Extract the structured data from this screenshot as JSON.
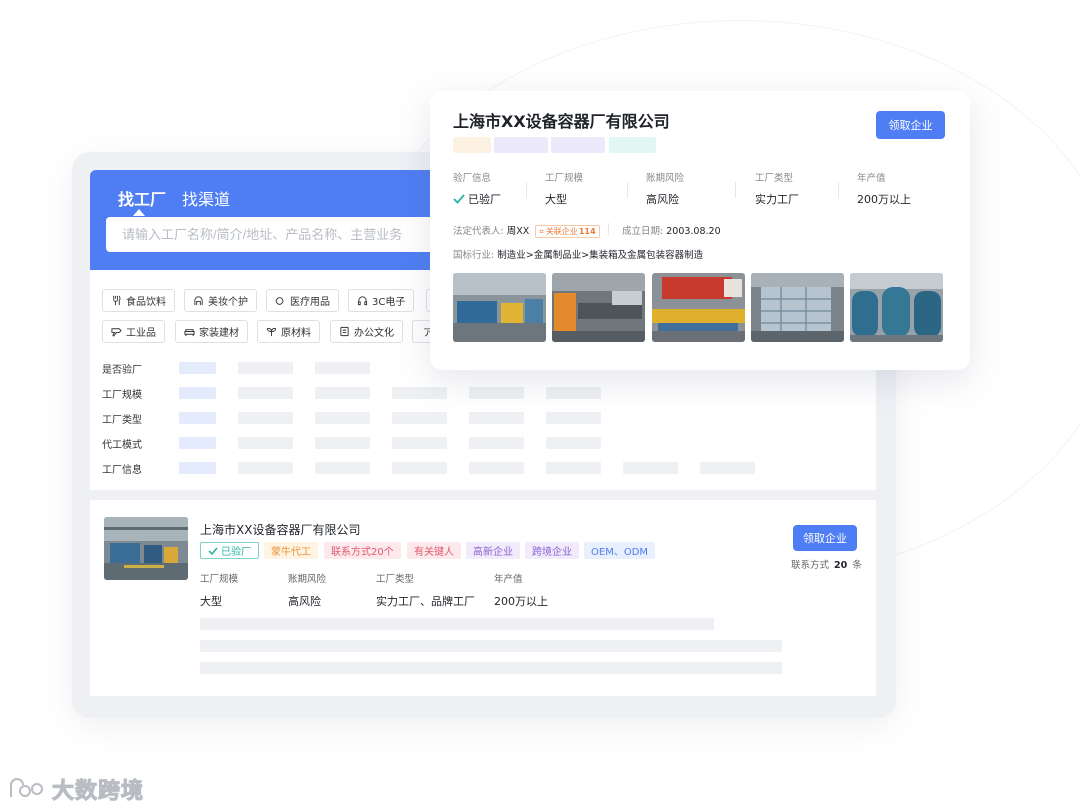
{
  "search": {
    "tabs": [
      {
        "label": "找工厂"
      },
      {
        "label": "找渠道"
      }
    ],
    "placeholder": "请输入工厂名称/简介/地址、产品名称、主营业务"
  },
  "categories": [
    {
      "label": "食品饮料",
      "icon": "food-icon"
    },
    {
      "label": "美妆个护",
      "icon": "beauty-icon"
    },
    {
      "label": "医疗用品",
      "icon": "medical-icon"
    },
    {
      "label": "3C电子",
      "icon": "headphone-icon"
    },
    {
      "label": "工业品",
      "icon": "tool-icon"
    },
    {
      "label": "家装建材",
      "icon": "sofa-icon"
    },
    {
      "label": "原材料",
      "icon": "material-icon"
    },
    {
      "label": "办公文化",
      "icon": "office-icon"
    }
  ],
  "filters": [
    {
      "label": "是否验厂"
    },
    {
      "label": "工厂规模"
    },
    {
      "label": "工厂类型"
    },
    {
      "label": "代工模式"
    },
    {
      "label": "工厂信息"
    }
  ],
  "list_item": {
    "name": "上海市XX设备容器厂有限公司",
    "tags": [
      {
        "label": "已验厂",
        "bg": "#ffffff",
        "fg": "#2bb3a0",
        "border": "#7fd3c6"
      },
      {
        "label": "蒙牛代工",
        "bg": "#fff3e2",
        "fg": "#e8953a"
      },
      {
        "label": "联系方式20个",
        "bg": "#fde9ec",
        "fg": "#e05a70"
      },
      {
        "label": "有关键人",
        "bg": "#fde9ec",
        "fg": "#e05a70"
      },
      {
        "label": "高新企业",
        "bg": "#f1ebfb",
        "fg": "#8a63d2"
      },
      {
        "label": "跨境企业",
        "bg": "#f1ebfb",
        "fg": "#8a63d2"
      },
      {
        "label": "OEM、ODM",
        "bg": "#e8effd",
        "fg": "#4f7df3"
      }
    ],
    "meta": [
      {
        "label": "工厂规模",
        "value": "大型"
      },
      {
        "label": "账期风险",
        "value": "高风险"
      },
      {
        "label": "工厂类型",
        "value": "实力工厂、品牌工厂"
      },
      {
        "label": "年产值",
        "value": "200万以上"
      }
    ],
    "claim_label": "领取企业",
    "contact_prefix": "联系方式",
    "contact_count": "20",
    "contact_suffix": "条"
  },
  "detail": {
    "name": "上海市XX设备容器厂有限公司",
    "claim_label": "领取企业",
    "badge_colors": [
      "#fdf1e3",
      "#ece9fb",
      "#ece9fb",
      "#e2f7f3"
    ],
    "stats": [
      {
        "label": "验厂信息",
        "value": "已验厂"
      },
      {
        "label": "工厂规模",
        "value": "大型"
      },
      {
        "label": "账期风险",
        "value": "高风险"
      },
      {
        "label": "工厂类型",
        "value": "实力工厂"
      },
      {
        "label": "年产值",
        "value": "200万以上"
      }
    ],
    "legal_rep_label": "法定代表人:",
    "legal_rep_value": "周XX",
    "related_label": "关联企业",
    "related_count": "114",
    "founded_label": "成立日期:",
    "founded_value": "2003.08.20",
    "industry_label": "国标行业:",
    "industry_value": "制造业>金属制品业>集装箱及金属包装容器制造"
  },
  "watermark": {
    "text": "大数跨境"
  },
  "colors": {
    "accent": "#4f7df3",
    "check": "#2bb3a0"
  }
}
